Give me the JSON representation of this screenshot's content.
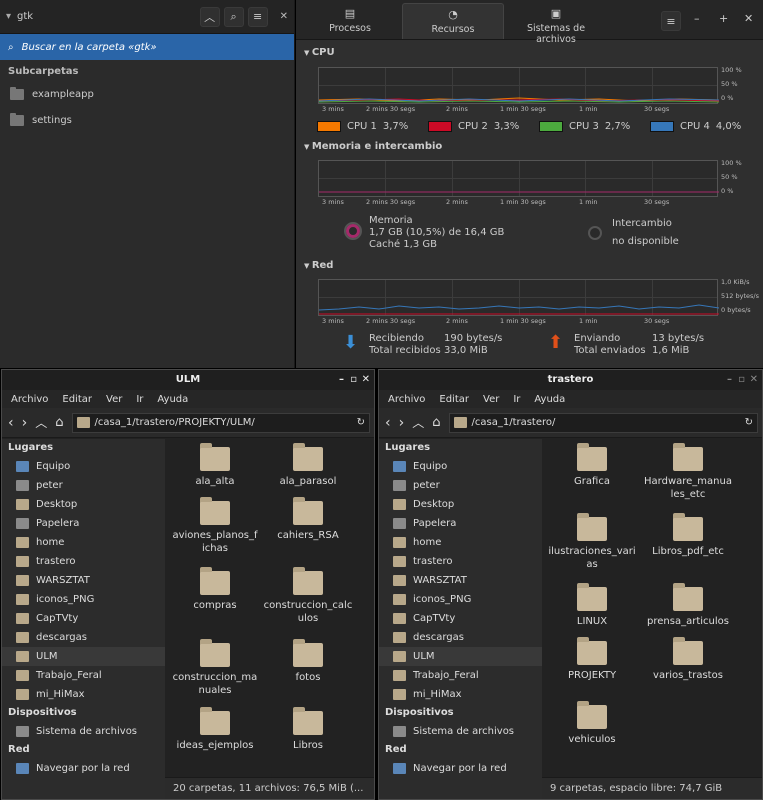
{
  "gtk": {
    "title": "gtk",
    "search_label": "Buscar en la carpeta «gtk»",
    "subfolders_heading": "Subcarpetas",
    "subfolders": [
      "exampleapp",
      "settings"
    ]
  },
  "monitor": {
    "tabs": [
      {
        "label": "Procesos",
        "icon": "processes-icon"
      },
      {
        "label": "Recursos",
        "icon": "resources-icon"
      },
      {
        "label": "Sistemas de archivos",
        "icon": "filesystems-icon"
      }
    ],
    "cpu": {
      "heading": "CPU",
      "pct_labels": [
        "100 %",
        "50 %",
        "0 %"
      ],
      "time_labels": [
        "3 mins",
        "2 mins 30 segs",
        "2 mins",
        "1 min 30 segs",
        "1 min",
        "30 segs"
      ],
      "legend": [
        {
          "name": "CPU 1",
          "value": "3,7%",
          "color": "#f57900"
        },
        {
          "name": "CPU 2",
          "value": "3,3%",
          "color": "#cc0a26"
        },
        {
          "name": "CPU 3",
          "value": "2,7%",
          "color": "#4caa3e"
        },
        {
          "name": "CPU 4",
          "value": "4,0%",
          "color": "#3677b9"
        }
      ]
    },
    "memory": {
      "heading": "Memoria e intercambio",
      "pct_labels": [
        "100 %",
        "50 %",
        "0 %"
      ],
      "time_labels": [
        "3 mins",
        "2 mins 30 segs",
        "2 mins",
        "1 min 30 segs",
        "1 min",
        "30 segs"
      ],
      "mem_title": "Memoria",
      "mem_line": "1,7  GB (10,5%) de 16,4  GB",
      "cache_line": "Caché 1,3  GB",
      "swap_title": "Intercambio",
      "swap_value": "no disponible"
    },
    "network": {
      "heading": "Red",
      "rate_labels": [
        "1,0  KiB/s",
        "512 bytes/s",
        "0 bytes/s"
      ],
      "time_labels": [
        "3 mins",
        "2 mins 30 segs",
        "2 mins",
        "1 min 30 segs",
        "1 min",
        "30 segs"
      ],
      "recv_label": "Recibiendo",
      "recv_rate": "190 bytes/s",
      "recv_total_label": "Total recibidos",
      "recv_total": "33,0  MiB",
      "send_label": "Enviando",
      "send_rate": "13 bytes/s",
      "send_total_label": "Total enviados",
      "send_total": "1,6  MiB"
    }
  },
  "ulm": {
    "title": "ULM",
    "menu": [
      "Archivo",
      "Editar",
      "Ver",
      "Ir",
      "Ayuda"
    ],
    "path": "/casa_1/trastero/PROJEKTY/ULM/",
    "places_heading": "Lugares",
    "places": [
      "Equipo",
      "peter",
      "Desktop",
      "Papelera",
      "home",
      "trastero",
      "WARSZTAT",
      "iconos_PNG",
      "CapTVty",
      "descargas",
      "ULM",
      "Trabajo_Feral",
      "mi_HiMax"
    ],
    "devices_heading": "Dispositivos",
    "devices": [
      "Sistema de archivos"
    ],
    "network_heading": "Red",
    "network": [
      "Navegar por la red"
    ],
    "items": [
      "ala_alta",
      "ala_parasol",
      "aviones_planos_f\nichas",
      "cahiers_RSA",
      "compras",
      "construccion_calc\nulos",
      "construccion_ma\nnuales",
      "fotos",
      "ideas_ejemplos",
      "Libros"
    ],
    "status": "20 carpetas, 11 archivos: 76,5  MiB (..."
  },
  "trastero": {
    "title": "trastero",
    "menu": [
      "Archivo",
      "Editar",
      "Ver",
      "Ir",
      "Ayuda"
    ],
    "path": "/casa_1/trastero/",
    "places_heading": "Lugares",
    "places": [
      "Equipo",
      "peter",
      "Desktop",
      "Papelera",
      "home",
      "trastero",
      "WARSZTAT",
      "iconos_PNG",
      "CapTVty",
      "descargas",
      "ULM",
      "Trabajo_Feral",
      "mi_HiMax"
    ],
    "devices_heading": "Dispositivos",
    "devices": [
      "Sistema de archivos"
    ],
    "network_heading": "Red",
    "network": [
      "Navegar por la red"
    ],
    "items": [
      "Grafica",
      "Hardware_manua\nles_etc",
      "ilustraciones_vari\nas",
      "Libros_pdf_etc",
      "LINUX",
      "prensa_articulos",
      "PROJEKTY",
      "varios_trastos",
      "vehiculos"
    ],
    "status": "9 carpetas, espacio libre: 74,7  GiB"
  }
}
